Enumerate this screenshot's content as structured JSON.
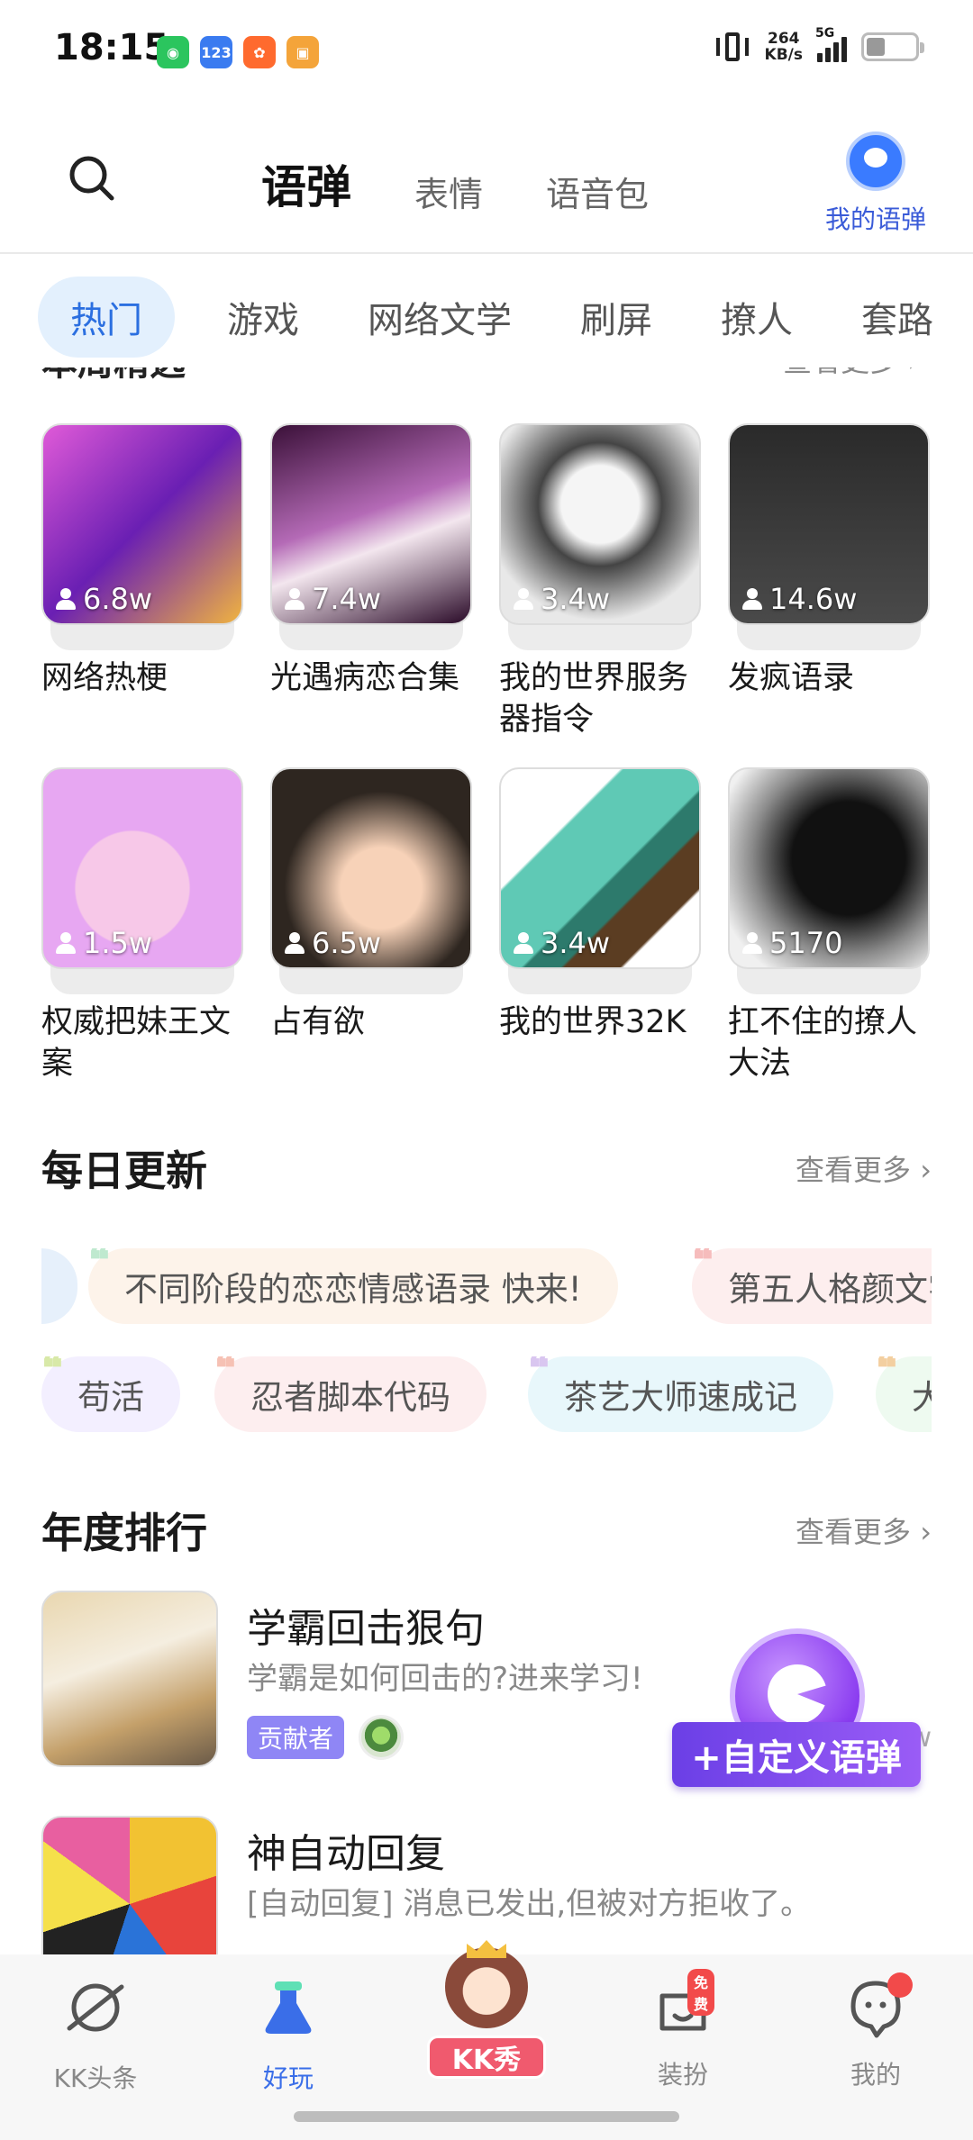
{
  "status": {
    "time": "18:15",
    "net_speed_top": "264",
    "net_speed_unit": "KB/s",
    "network": "5G",
    "apps": [
      {
        "name": "wechat-icon",
        "color": "#2bc55e"
      },
      {
        "name": "123-app-icon",
        "color": "#3a7bf0"
      },
      {
        "name": "orange-app-icon",
        "color": "#ff6a2e"
      },
      {
        "name": "game-app-icon",
        "color": "#f4a43a"
      }
    ]
  },
  "header": {
    "tabs": [
      "语弹",
      "表情",
      "语音包"
    ],
    "active_tab": "语弹",
    "my_yudan": "我的语弹"
  },
  "categories": [
    "热门",
    "游戏",
    "网络文学",
    "刷屏",
    "撩人",
    "套路"
  ],
  "weekly": {
    "title": "本周精选",
    "more": "查看更多 ›"
  },
  "cards": [
    {
      "title": "网络热梗",
      "count": "6.8w",
      "bg": "linear-gradient(135deg,#e05ad8,#6a1fb3 50%,#f0b340)"
    },
    {
      "title": "光遇病恋合集",
      "count": "7.4w",
      "bg": "linear-gradient(160deg,#3a1038,#b46ab6 45%,#f3e6ee 60%,#2a0a28)"
    },
    {
      "title": "我的世界服务器指令",
      "count": "3.4w",
      "bg": "radial-gradient(circle at 50% 40%,#f5f5f5 0 25%,#444 40%,#e8e8e8 75%)"
    },
    {
      "title": "发疯语录",
      "count": "14.6w",
      "bg": "linear-gradient(180deg,#2a2a2a,#4a4a4a)"
    },
    {
      "title": "权威把妹王文案",
      "count": "1.5w",
      "bg": "radial-gradient(circle at 45% 60%,#f7c8e8 0 35%,#e7a7f2 36% 100%)"
    },
    {
      "title": "占有欲",
      "count": "6.5w",
      "bg": "radial-gradient(circle at 55% 60%,#f7d2b8 0 25%,#2e2620 60%)"
    },
    {
      "title": "我的世界32K",
      "count": "3.4w",
      "bg": "linear-gradient(135deg,#ffffff 0 30%,#5fc9b5 31% 55%,#2d7a6c 56% 65%,#5b3d22 66% 80%,#ffffff 81%)"
    },
    {
      "title": "扛不住的撩人大法",
      "count": "5170",
      "bg": "radial-gradient(circle at 60% 45%,#111 0 35%,#8a8a8a 60%,#f0f0f0 85%)"
    }
  ],
  "daily": {
    "title": "每日更新",
    "more": "查看更多 ›",
    "row1": [
      {
        "text": "不同阶段的恋恋情感语录 快来!",
        "bg": "#fdf3ea",
        "quote": "#bfe9cf"
      },
      {
        "text": "第五人格颜文字",
        "bg": "#fdeeee",
        "quote": "#f6bcbc"
      }
    ],
    "row2": [
      {
        "text": "苟活",
        "bg": "#f3efff",
        "quote": "#d8e9a8"
      },
      {
        "text": "忍者脚本代码",
        "bg": "#fdeeef",
        "quote": "#f6c1b4"
      },
      {
        "text": "茶艺大师速成记",
        "bg": "#e8f7fb",
        "quote": "#d9c6f0"
      },
      {
        "text": "大",
        "bg": "#eefaf0",
        "quote": "#f3cfa0"
      }
    ]
  },
  "ranking": {
    "title": "年度排行",
    "more": "查看更多 ›",
    "items": [
      {
        "title": "学霸回击狠句",
        "desc": "学霸是如何回击的?进来学习!",
        "badge": "贡献者",
        "tail": "w"
      },
      {
        "title": "神自动回复",
        "desc": "[自动回复] 消息已发出,但被对方拒收了。",
        "badge": "",
        "tail": ""
      }
    ]
  },
  "fab": {
    "label": "+自定义语弹"
  },
  "nav": [
    {
      "label": "KK头条",
      "icon": "planet-icon"
    },
    {
      "label": "好玩",
      "icon": "flask-icon"
    },
    {
      "label": "KK秀",
      "icon": "kk-show-icon"
    },
    {
      "label": "装扮",
      "icon": "dressup-icon"
    },
    {
      "label": "我的",
      "icon": "profile-icon"
    }
  ],
  "nav_free_tag": "免费",
  "colors": {
    "accent": "#3a6ee8",
    "brand_purple": "#7b45ec"
  }
}
